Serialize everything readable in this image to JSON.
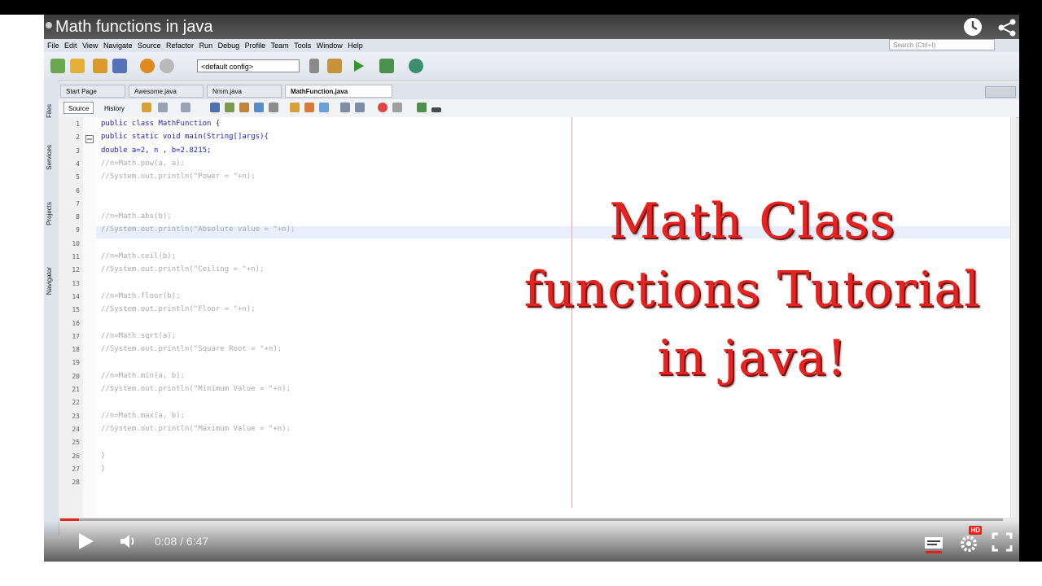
{
  "video": {
    "title": "Math functions in java",
    "current_time": "0:08",
    "duration": "6:47",
    "time_separator": " / ",
    "progress": 0.02,
    "hd_badge": "HD",
    "accent_color": "#e62117"
  },
  "ide": {
    "menu": [
      "File",
      "Edit",
      "View",
      "Navigate",
      "Source",
      "Refactor",
      "Run",
      "Debug",
      "Profile",
      "Team",
      "Tools",
      "Window",
      "Help"
    ],
    "search_placeholder": "Search (Ctrl+I)",
    "config": "<default config>",
    "side_panels": [
      "Files",
      "Services",
      "Projects",
      "Navigator"
    ],
    "tabs": [
      {
        "label": "Start Page",
        "active": false
      },
      {
        "label": "Awesome.java",
        "active": false
      },
      {
        "label": "Nmm.java",
        "active": false
      },
      {
        "label": "MathFunction.java",
        "active": true
      }
    ],
    "editor_buttons": {
      "source": "Source",
      "history": "History"
    },
    "code_lines": [
      {
        "n": "1",
        "text": "public class MathFunction {",
        "style": "kw"
      },
      {
        "n": "2",
        "text": "public static void main(String[]args){",
        "style": "kw"
      },
      {
        "n": "3",
        "text": "double a=2, n , b=2.8215;",
        "style": "kw"
      },
      {
        "n": "4",
        "text": "//n=Math.pow(a, a);",
        "style": "comment"
      },
      {
        "n": "5",
        "text": "//System.out.println(\"Power = \"+n);",
        "style": "comment"
      },
      {
        "n": "6",
        "text": "",
        "style": "comment"
      },
      {
        "n": "7",
        "text": "",
        "style": "comment"
      },
      {
        "n": "8",
        "text": "//n=Math.abs(b);",
        "style": "comment"
      },
      {
        "n": "9",
        "text": "//System.out.println(\"Absolute value = \"+n);",
        "style": "comment"
      },
      {
        "n": "10",
        "text": "",
        "style": "comment"
      },
      {
        "n": "11",
        "text": "//n=Math.ceil(b);",
        "style": "comment"
      },
      {
        "n": "12",
        "text": "//System.out.println(\"Ceiling = \"+n);",
        "style": "comment"
      },
      {
        "n": "13",
        "text": "",
        "style": "comment"
      },
      {
        "n": "14",
        "text": "//n=Math.floor(b);",
        "style": "comment"
      },
      {
        "n": "15",
        "text": "//System.out.println(\"Floor = \"+n);",
        "style": "comment"
      },
      {
        "n": "16",
        "text": "",
        "style": "comment"
      },
      {
        "n": "17",
        "text": "//n=Math.sqrt(a);",
        "style": "comment"
      },
      {
        "n": "18",
        "text": "//System.out.println(\"Square Root = \"+n);",
        "style": "comment"
      },
      {
        "n": "19",
        "text": "",
        "style": "comment"
      },
      {
        "n": "20",
        "text": "//n=Math.min(a, b);",
        "style": "comment"
      },
      {
        "n": "21",
        "text": "//System.out.println(\"Minimum Value = \"+n);",
        "style": "comment"
      },
      {
        "n": "22",
        "text": "",
        "style": "comment"
      },
      {
        "n": "23",
        "text": "//n=Math.max(a, b);",
        "style": "comment"
      },
      {
        "n": "24",
        "text": "//System.out.println(\"Maximum Value = \"+n);",
        "style": "comment"
      },
      {
        "n": "25",
        "text": "",
        "style": "comment"
      },
      {
        "n": "26",
        "text": "}",
        "style": "comment"
      },
      {
        "n": "27",
        "text": "}",
        "style": "comment"
      },
      {
        "n": "28",
        "text": "",
        "style": "comment"
      }
    ]
  },
  "overlay": {
    "line1": "Math Class",
    "line2": "functions Tutorial",
    "line3": "in java!",
    "color": "#e8231f"
  },
  "icons": [
    "watch-later-icon",
    "share-icon",
    "play-icon",
    "volume-icon",
    "subtitles-icon",
    "settings-icon",
    "fullscreen-icon"
  ]
}
